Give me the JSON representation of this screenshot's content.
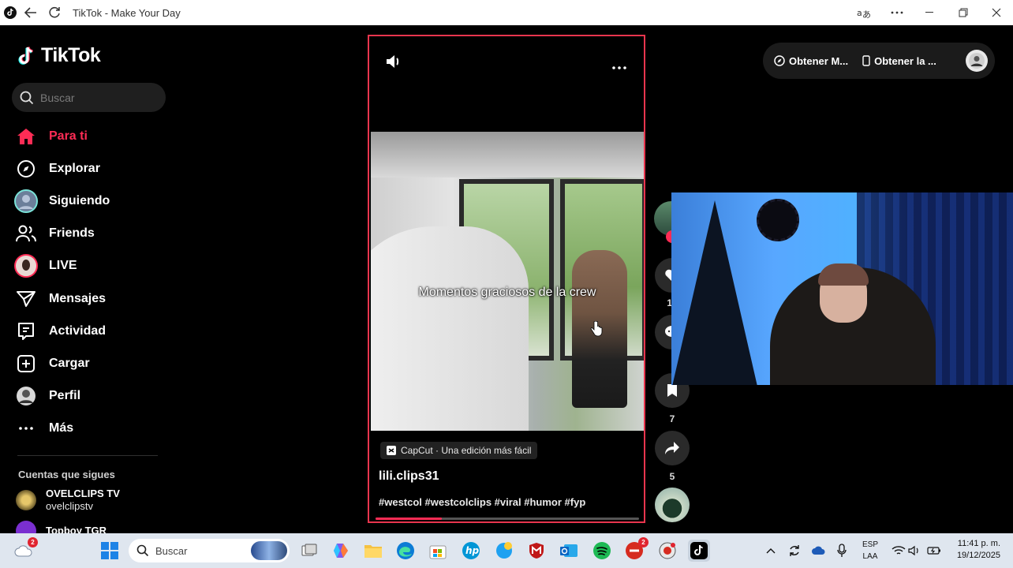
{
  "window": {
    "title": "TikTok - Make Your Day"
  },
  "sidebar": {
    "logo": "TikTok",
    "search_placeholder": "Buscar",
    "nav": [
      {
        "label": "Para ti",
        "icon": "home-icon",
        "active": true
      },
      {
        "label": "Explorar",
        "icon": "compass-icon"
      },
      {
        "label": "Siguiendo",
        "icon": "following-avatar-icon"
      },
      {
        "label": "Friends",
        "icon": "friends-icon"
      },
      {
        "label": "LIVE",
        "icon": "live-avatar-icon"
      },
      {
        "label": "Mensajes",
        "icon": "send-icon"
      },
      {
        "label": "Actividad",
        "icon": "activity-icon"
      },
      {
        "label": "Cargar",
        "icon": "upload-icon"
      },
      {
        "label": "Perfil",
        "icon": "profile-avatar-icon"
      },
      {
        "label": "Más",
        "icon": "more-icon"
      }
    ],
    "following_title": "Cuentas que sigues",
    "accounts": [
      {
        "name": "OVELCLIPS TV",
        "handle": "ovelclipstv"
      },
      {
        "name": "Topboy TGR",
        "handle": ""
      }
    ]
  },
  "video": {
    "caption": "Momentos graciosos de la crew",
    "capcut_tag": "CapCut · Una edición más fácil",
    "username": "lili.clips31",
    "hashtags": "#westcol #westcolclips #viral #humor #fyp",
    "progress": 0.25
  },
  "actions": {
    "likes": "10",
    "comments": "",
    "saves": "7",
    "shares": "5"
  },
  "header": {
    "get_app_1": "Obtener M...",
    "get_app_2": "Obtener la ..."
  },
  "taskbar": {
    "search_placeholder": "Buscar",
    "weather_badge": "2",
    "app_badge": "2",
    "lang_top": "ESP",
    "lang_bottom": "LAA",
    "time": "11:41 p. m.",
    "date": "19/12/2025"
  },
  "colors": {
    "accent": "#fe2c55",
    "card_border": "#e8354e",
    "taskbar": "#dfe6ef"
  }
}
